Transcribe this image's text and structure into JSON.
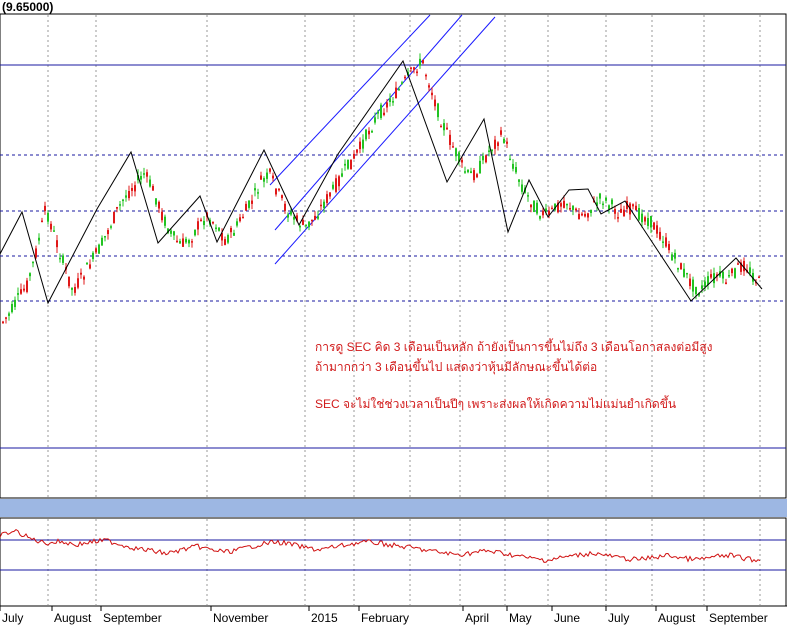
{
  "header": {
    "price_label": "(9.65000)"
  },
  "annotations": [
    "การดู SEC  คิด 3  เดือนเป็นหลัก ถ้ายังเป็นการขึ้นไม่ถึง 3  เดือนโอกาสลงต่อมีสูง",
    "ถ้ามากกว่า  3  เดือนขึ้นไป แสดงว่าหุ้นมีลักษณะขึ้นได้ต่อ",
    "SEC จะไม่ใช่ช่วงเวลาเป็นปีๆ เพราะส่งผลให้เกิดความไม่แม่นยำเกิดขึ้น"
  ],
  "colors": {
    "up_candle": "#22c322",
    "down_candle": "#e01818",
    "trend_line": "#000000",
    "channel_line": "#1a1aff",
    "level_line": "#1a1aa0",
    "oscillator_line": "#d01010",
    "separator_bar": "#9db7e3"
  },
  "chart_data": {
    "type": "candlestick",
    "x_tick_labels": [
      "July",
      "August",
      "September",
      "November",
      "2015",
      "February",
      "April",
      "May",
      "June",
      "July",
      "August",
      "September"
    ],
    "price_last": 9.65,
    "price_series_relative": [
      0.12,
      0.18,
      0.27,
      0.35,
      0.55,
      0.78,
      0.62,
      0.46,
      0.31,
      0.38,
      0.47,
      0.55,
      0.66,
      0.77,
      0.86,
      0.92,
      0.98,
      0.88,
      0.74,
      0.63,
      0.57,
      0.6,
      0.68,
      0.74,
      0.69,
      0.6,
      0.65,
      0.74,
      0.82,
      0.93,
      0.97,
      0.86,
      0.76,
      0.71,
      0.67,
      0.73,
      0.81,
      0.88,
      0.97,
      1.04,
      1.12,
      1.22,
      1.31,
      1.37,
      1.43,
      1.5,
      1.57,
      1.62,
      1.46,
      1.3,
      1.18,
      1.07,
      0.97,
      0.98,
      1.07,
      1.15,
      1.2,
      1.05,
      0.92,
      0.83,
      0.76,
      0.74,
      0.79,
      0.83,
      0.76,
      0.74,
      0.79,
      0.84,
      0.8,
      0.75,
      0.79,
      0.75,
      0.73,
      0.67,
      0.6,
      0.5,
      0.43,
      0.35,
      0.31,
      0.37,
      0.4,
      0.36,
      0.43,
      0.46,
      0.39,
      0.33
    ],
    "oscillator_series_relative": [
      0.72,
      0.8,
      0.66,
      0.58,
      0.61,
      0.55,
      0.6,
      0.63,
      0.55,
      0.48,
      0.44,
      0.39,
      0.46,
      0.52,
      0.45,
      0.42,
      0.48,
      0.55,
      0.6,
      0.57,
      0.5,
      0.46,
      0.51,
      0.56,
      0.6,
      0.58,
      0.53,
      0.5,
      0.45,
      0.41,
      0.37,
      0.4,
      0.44,
      0.4,
      0.35,
      0.3,
      0.27,
      0.32,
      0.36,
      0.4,
      0.35,
      0.3,
      0.28,
      0.32,
      0.36,
      0.3,
      0.28,
      0.33,
      0.36,
      0.3,
      0.26
    ],
    "grid": true
  }
}
